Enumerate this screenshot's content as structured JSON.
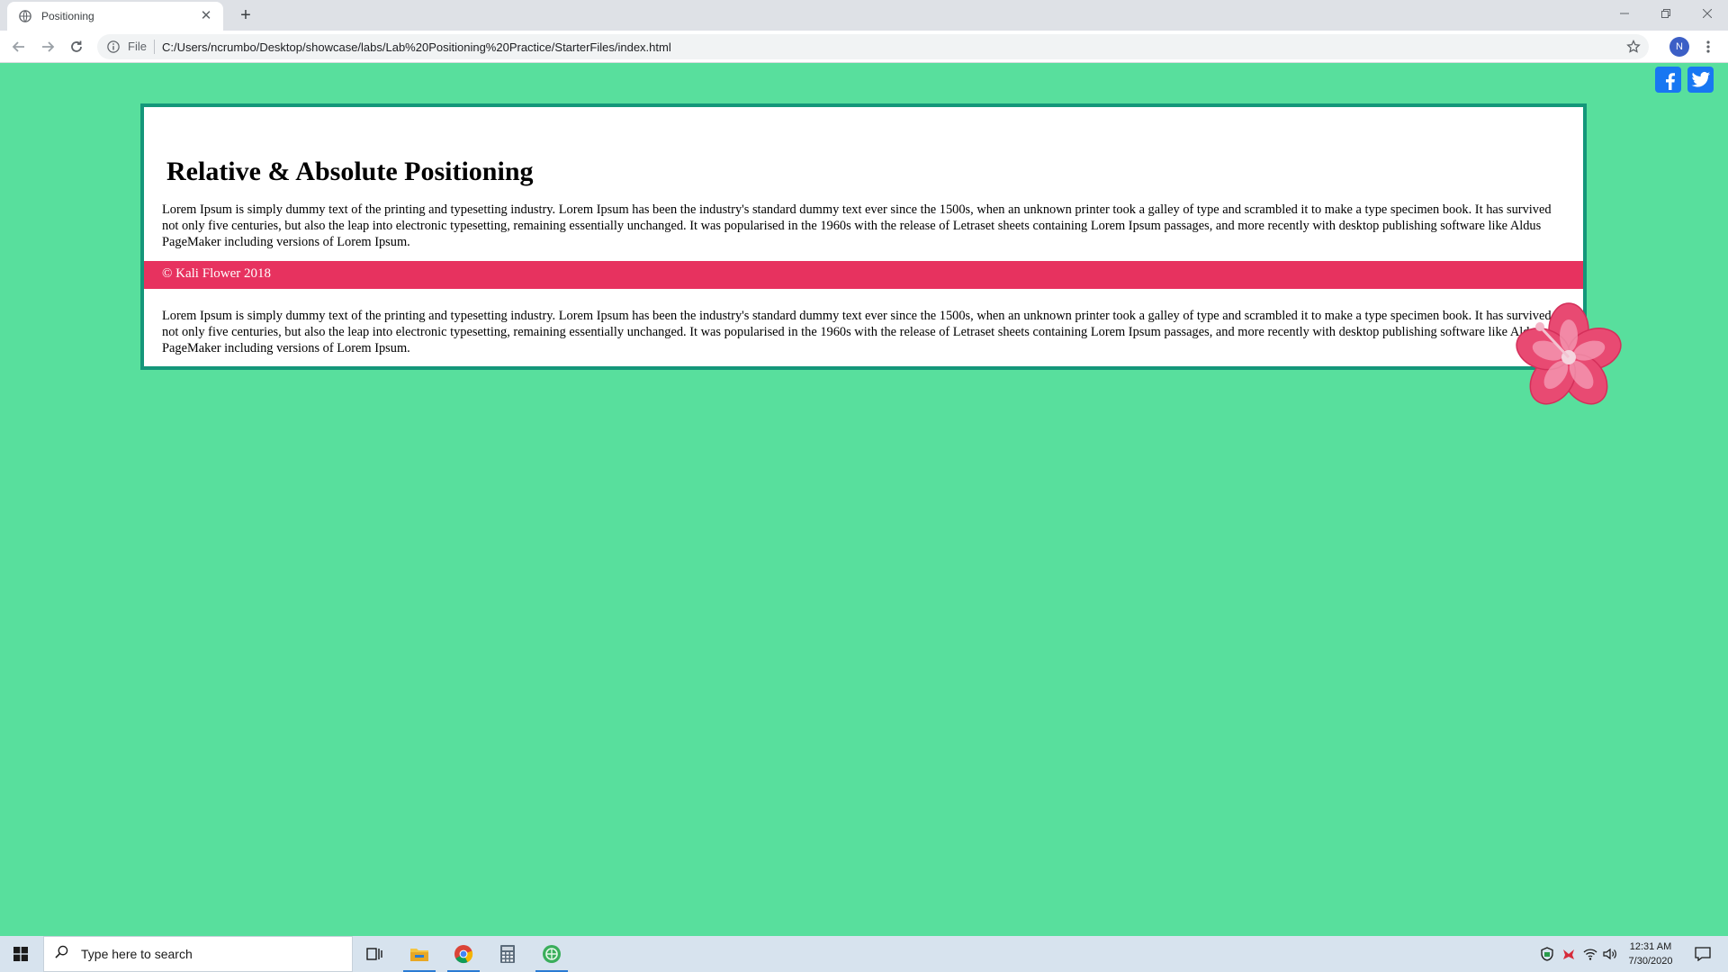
{
  "browser": {
    "tab_title": "Positioning",
    "new_tab_label": "+",
    "omnibox_scheme": "File",
    "url": "C:/Users/ncrumbo/Desktop/showcase/labs/Lab%20Positioning%20Practice/StarterFiles/index.html",
    "profile_initial": "N"
  },
  "page": {
    "heading": "Relative & Absolute Positioning",
    "paragraph1": "Lorem Ipsum is simply dummy text of the printing and typesetting industry. Lorem Ipsum has been the industry's standard dummy text ever since the 1500s, when an unknown printer took a galley of type and scrambled it to make a type specimen book. It has survived not only five centuries, but also the leap into electronic typesetting, remaining essentially unchanged. It was popularised in the 1960s with the release of Letraset sheets containing Lorem Ipsum passages, and more recently with desktop publishing software like Aldus PageMaker including versions of Lorem Ipsum.",
    "footer": "© Kali Flower 2018",
    "paragraph2": "Lorem Ipsum is simply dummy text of the printing and typesetting industry. Lorem Ipsum has been the industry's standard dummy text ever since the 1500s, when an unknown printer took a galley of type and scrambled it to make a type specimen book. It has survived not only five centuries, but also the leap into electronic typesetting, remaining essentially unchanged. It was popularised in the 1960s with the release of Letraset sheets containing Lorem Ipsum passages, and more recently with desktop publishing software like Aldus PageMaker including versions of Lorem Ipsum.",
    "social_icons": [
      "facebook-icon",
      "twitter-icon"
    ],
    "decoration": "hibiscus-flower-icon"
  },
  "taskbar": {
    "search_placeholder": "Type here to search",
    "time": "12:31 AM",
    "date": "7/30/2020",
    "apps": [
      "task-view-icon",
      "file-explorer-icon",
      "chrome-icon",
      "calculator-icon",
      "app-icon"
    ]
  },
  "colors": {
    "page_background": "#58df9d",
    "card_border": "#14977a",
    "footer_background": "#e7325f",
    "social_blue": "#1877f2"
  }
}
